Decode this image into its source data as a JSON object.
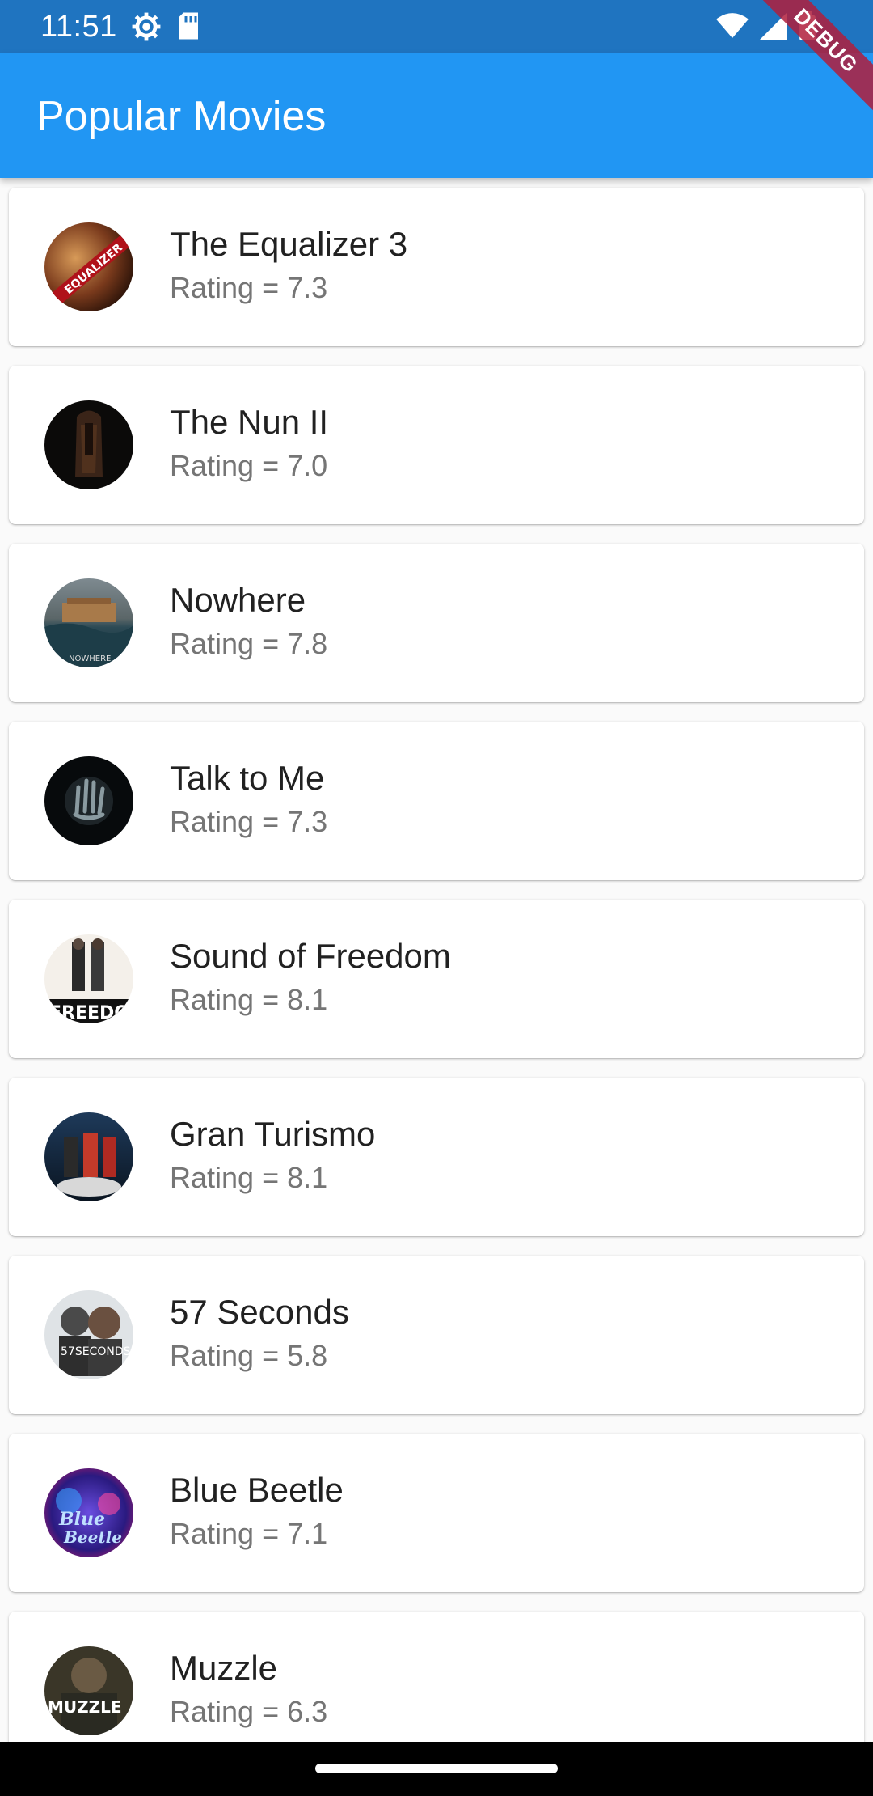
{
  "status_bar": {
    "time": "11:51",
    "left_icons": [
      "gear-icon",
      "sd-card-icon"
    ],
    "right_icons": [
      "wifi-icon",
      "signal-icon",
      "battery-icon"
    ]
  },
  "app_bar": {
    "title": "Popular Movies",
    "debug_label": "DEBUG",
    "color": "#2196f3"
  },
  "movies": [
    {
      "title": "The Equalizer 3",
      "rating": "Rating = 7.3"
    },
    {
      "title": "The Nun II",
      "rating": "Rating = 7.0"
    },
    {
      "title": "Nowhere",
      "rating": "Rating = 7.8"
    },
    {
      "title": "Talk to Me",
      "rating": "Rating = 7.3"
    },
    {
      "title": "Sound of Freedom",
      "rating": "Rating = 8.1"
    },
    {
      "title": "Gran Turismo",
      "rating": "Rating = 8.1"
    },
    {
      "title": "57 Seconds",
      "rating": "Rating = 5.8"
    },
    {
      "title": "Blue Beetle",
      "rating": "Rating = 7.1"
    },
    {
      "title": "Muzzle",
      "rating": "Rating = 6.3"
    }
  ]
}
